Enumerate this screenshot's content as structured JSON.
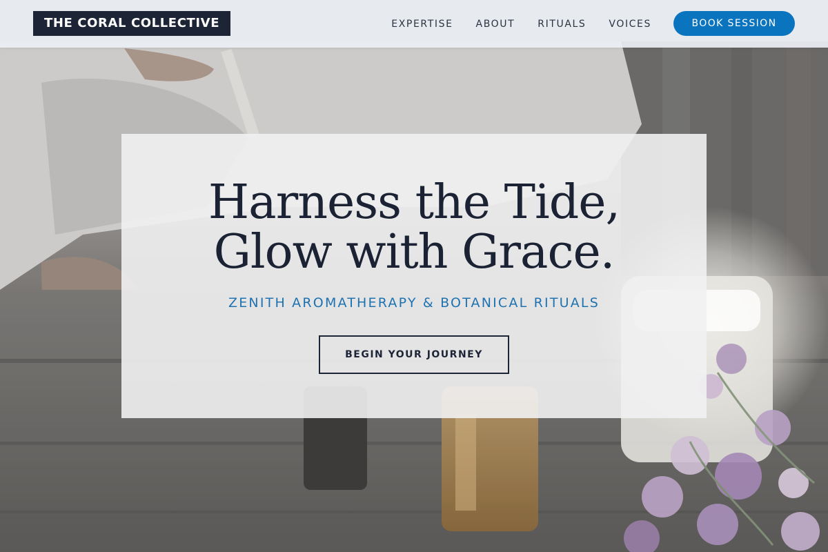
{
  "brand": {
    "name": "THE CORAL COLLECTIVE"
  },
  "nav": {
    "links": [
      {
        "label": "EXPERTISE"
      },
      {
        "label": "ABOUT"
      },
      {
        "label": "RITUALS"
      },
      {
        "label": "VOICES"
      }
    ],
    "cta_label": "BOOK SESSION"
  },
  "hero": {
    "title_line1": "Harness the Tide,",
    "title_line2": "Glow with Grace.",
    "subtitle": "ZENITH AROMATHERAPY & BOTANICAL RITUALS",
    "button_label": "BEGIN YOUR JOURNEY"
  },
  "colors": {
    "brand_dark": "#1c2436",
    "accent_blue": "#0a74bf",
    "subtitle_blue": "#1e72b0",
    "nav_bg": "#ebeef3"
  }
}
